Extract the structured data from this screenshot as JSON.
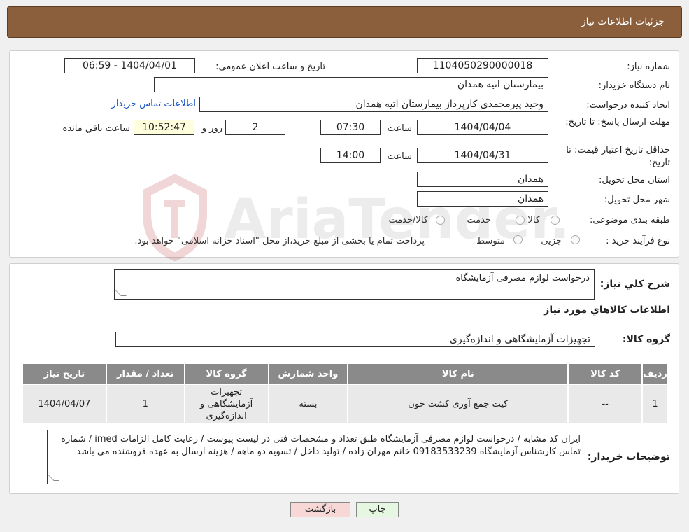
{
  "header": {
    "title": "جزئیات اطلاعات نیاز"
  },
  "info": {
    "need_number_label": "شماره نیاز:",
    "need_number": "1104050290000018",
    "announce_label": "تاریخ و ساعت اعلان عمومی:",
    "announce_value": "1404/04/01 - 06:59",
    "buyer_org_label": "نام دستگاه خریدار:",
    "buyer_org": "بیمارستان اتیه همدان",
    "creator_label": "ایجاد کننده درخواست:",
    "creator": "وحید پیرمحمدی کارپرداز بیمارستان اتیه همدان",
    "contact_link": "اطلاعات تماس خریدار",
    "deadline_label": "مهلت ارسال پاسخ: تا تاریخ:",
    "deadline_date": "1404/04/04",
    "time_label": "ساعت",
    "deadline_time": "07:30",
    "days_value": "2",
    "days_label": "روز و",
    "remaining_time": "10:52:47",
    "remaining_label": "ساعت باقي مانده",
    "validity_label": "حداقل تاریخ اعتبار قیمت: تا تاریخ:",
    "validity_date": "1404/04/31",
    "validity_time": "14:00",
    "province_label": "استان محل تحویل:",
    "province": "همدان",
    "city_label": "شهر محل تحویل:",
    "city": "همدان",
    "category_label": "طبقه بندی موضوعی:",
    "category_options": [
      "کالا",
      "خدمت",
      "کالا/خدمت"
    ],
    "process_label": "نوع فرآیند خرید :",
    "process_options": [
      "جزیی",
      "متوسط"
    ],
    "process_note": "پرداخت تمام یا بخشی از مبلغ خرید،از محل \"اسناد خزانه اسلامی\" خواهد بود."
  },
  "details": {
    "summary_label": "شرح کلي نياز:",
    "summary": "درخواست لوازم مصرفی آزمایشگاه",
    "goods_heading": "اطلاعات کالاهاي مورد نياز",
    "group_label": "گروه کالا:",
    "group_value": "تجهیزات آزمایشگاهی و اندازه‌گیری",
    "table": {
      "headers": [
        "ردیف",
        "کد کالا",
        "نام کالا",
        "واحد شمارش",
        "گروه کالا",
        "تعداد / مقدار",
        "تاریخ نیاز"
      ],
      "rows": [
        [
          "1",
          "--",
          "کیت جمع آوری کشت خون",
          "بسته",
          "تجهیزات آزمایشگاهی و اندازه‌گیری",
          "1",
          "1404/04/07"
        ]
      ]
    },
    "buyer_notes_label": "توضیحات خریدار:",
    "buyer_notes": "ایران کد مشابه / درخواست لوازم مصرفی آزمایشگاه طبق تعداد و مشخصات فنی در لیست پیوست / رعایت کامل الزامات imed / شماره تماس کارشناس آزمایشگاه 09183533239 خانم مهران زاده / تولید داخل / تسویه دو ماهه / هزینه ارسال به عهده فروشنده می باشد"
  },
  "buttons": {
    "print": "چاپ",
    "back": "بازگشت"
  },
  "watermark": "AriaTender.neT",
  "colors": {
    "header_bg": "#8b5e3c",
    "table_header": "#8a8a8a",
    "back_button": "#f8d7d7",
    "print_button": "#e5f7e0",
    "link": "#1a55c7"
  }
}
